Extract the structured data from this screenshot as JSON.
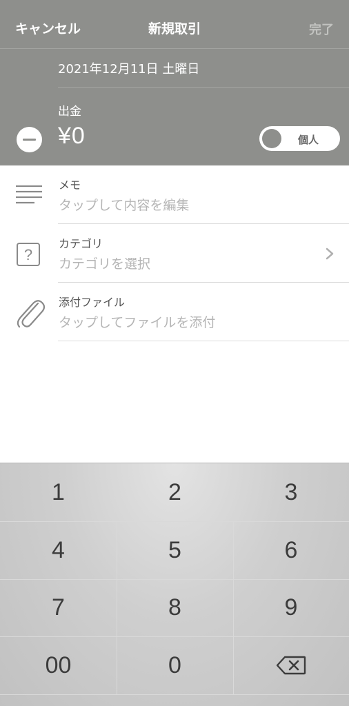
{
  "navbar": {
    "cancel_label": "キャンセル",
    "title": "新規取引",
    "done_label": "完了"
  },
  "transaction": {
    "date": "2021年12月11日 土曜日",
    "type_label": "出金",
    "amount": "¥0",
    "toggle_label": "個人",
    "toggle_on": false
  },
  "fields": {
    "memo": {
      "label": "メモ",
      "placeholder": "タップして内容を編集",
      "icon": "lines-icon"
    },
    "category": {
      "label": "カテゴリ",
      "placeholder": "カテゴリを選択",
      "icon": "question-box-icon"
    },
    "attachment": {
      "label": "添付ファイル",
      "placeholder": "タップしてファイルを添付",
      "icon": "paperclip-icon"
    }
  },
  "keypad": {
    "keys": [
      "1",
      "2",
      "3",
      "4",
      "5",
      "6",
      "7",
      "8",
      "9",
      "00",
      "0"
    ],
    "backspace_icon": "backspace-icon"
  },
  "colors": {
    "header_bg": "#8e8f8c",
    "placeholder": "#b5b5b5",
    "keypad_bg": "#cfcfcf"
  }
}
